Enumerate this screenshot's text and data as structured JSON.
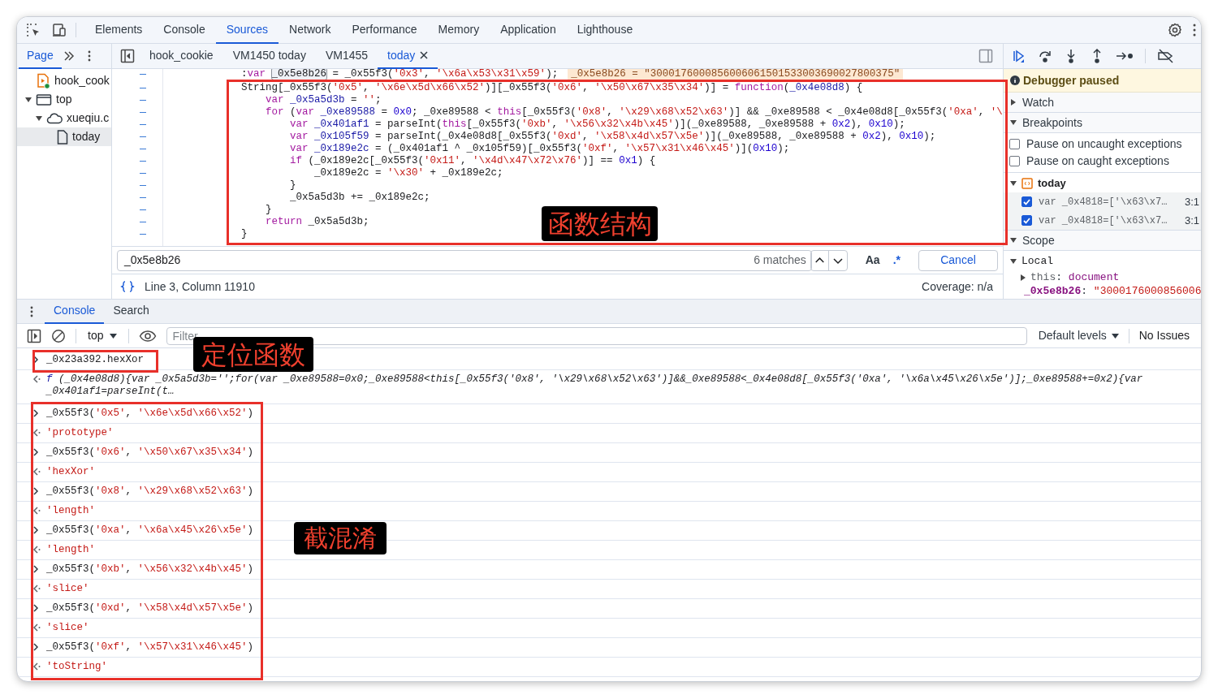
{
  "tabs": [
    {
      "label": "Elements",
      "selected": false
    },
    {
      "label": "Console",
      "selected": false
    },
    {
      "label": "Sources",
      "selected": true
    },
    {
      "label": "Network",
      "selected": false
    },
    {
      "label": "Performance",
      "selected": false
    },
    {
      "label": "Memory",
      "selected": false
    },
    {
      "label": "Application",
      "selected": false
    },
    {
      "label": "Lighthouse",
      "selected": false
    }
  ],
  "navigator": {
    "tabs": [
      {
        "label": "Page",
        "selected": true
      }
    ],
    "tree": [
      {
        "label": "hook_cook",
        "kind": "script",
        "selected": false
      },
      {
        "label": "top",
        "kind": "frame",
        "expanded": true,
        "selected": false,
        "children": [
          {
            "label": "xueqiu.c",
            "kind": "origin",
            "expanded": true,
            "selected": false,
            "children": [
              {
                "label": "today",
                "kind": "file",
                "selected": true
              }
            ]
          }
        ]
      }
    ]
  },
  "editor": {
    "tabs": [
      {
        "label": "hook_cookie",
        "selected": false,
        "closable": false
      },
      {
        "label": "VM1450 today",
        "selected": false,
        "closable": false
      },
      {
        "label": "VM1455",
        "selected": false,
        "closable": false
      },
      {
        "label": "today",
        "selected": true,
        "closable": true
      }
    ],
    "lines": [
      {
        "tokens": [
          {
            "kind": "p",
            "text": ":"
          },
          {
            "kind": "kw",
            "text": "var "
          },
          {
            "kind": "hl",
            "text": "_0x5e8b26"
          },
          {
            "kind": "p",
            "text": " = _0x55f3("
          },
          {
            "kind": "s",
            "text": "'0x3'"
          },
          {
            "kind": "p",
            "text": ", "
          },
          {
            "kind": "s",
            "text": "'\\x6a\\x53\\x31\\x59'"
          },
          {
            "kind": "p",
            "text": ");"
          }
        ],
        "inline_value": "_0x5e8b26 = \"3000176000856006061501533003690027800375\""
      },
      {
        "tokens": [
          {
            "kind": "p",
            "text": "String[_0x55f3("
          },
          {
            "kind": "s",
            "text": "'0x5'"
          },
          {
            "kind": "p",
            "text": ", "
          },
          {
            "kind": "s",
            "text": "'\\x6e\\x5d\\x66\\x52'"
          },
          {
            "kind": "p",
            "text": ")][_0x55f3("
          },
          {
            "kind": "s",
            "text": "'0x6'"
          },
          {
            "kind": "p",
            "text": ", "
          },
          {
            "kind": "s",
            "text": "'\\x50\\x67\\x35\\x34'"
          },
          {
            "kind": "p",
            "text": ")] = "
          },
          {
            "kind": "kw",
            "text": "function"
          },
          {
            "kind": "p",
            "text": "("
          },
          {
            "kind": "def",
            "text": "_0x4e08d8"
          },
          {
            "kind": "p",
            "text": ") {"
          }
        ]
      },
      {
        "tokens": [
          {
            "kind": "kw",
            "text": "    var"
          },
          {
            "kind": "def",
            "text": " _0x5a5d3b"
          },
          {
            "kind": "p",
            "text": " = "
          },
          {
            "kind": "s",
            "text": "''"
          },
          {
            "kind": "p",
            "text": ";"
          }
        ]
      },
      {
        "tokens": [
          {
            "kind": "kw",
            "text": "    for"
          },
          {
            "kind": "p",
            "text": " ("
          },
          {
            "kind": "kw",
            "text": "var"
          },
          {
            "kind": "def",
            "text": " _0xe89588"
          },
          {
            "kind": "p",
            "text": " = "
          },
          {
            "kind": "n",
            "text": "0x0"
          },
          {
            "kind": "p",
            "text": "; _0xe89588 < "
          },
          {
            "kind": "kw",
            "text": "this"
          },
          {
            "kind": "p",
            "text": "[_0x55f3("
          },
          {
            "kind": "s",
            "text": "'0x8'"
          },
          {
            "kind": "p",
            "text": ", "
          },
          {
            "kind": "s",
            "text": "'\\x29\\x68\\x52\\x63'"
          },
          {
            "kind": "p",
            "text": ")] && _0xe89588 < _0x4e08d8[_0x55f3("
          },
          {
            "kind": "s",
            "text": "'0xa'"
          },
          {
            "kind": "p",
            "text": ", "
          },
          {
            "kind": "s",
            "text": "'\\"
          }
        ]
      },
      {
        "tokens": [
          {
            "kind": "kw",
            "text": "        var"
          },
          {
            "kind": "def",
            "text": " _0x401af1"
          },
          {
            "kind": "p",
            "text": " = parseInt("
          },
          {
            "kind": "kw",
            "text": "this"
          },
          {
            "kind": "p",
            "text": "[_0x55f3("
          },
          {
            "kind": "s",
            "text": "'0xb'"
          },
          {
            "kind": "p",
            "text": ", "
          },
          {
            "kind": "s",
            "text": "'\\x56\\x32\\x4b\\x45'"
          },
          {
            "kind": "p",
            "text": ")](_0xe89588, _0xe89588 + "
          },
          {
            "kind": "n",
            "text": "0x2"
          },
          {
            "kind": "p",
            "text": "), "
          },
          {
            "kind": "n",
            "text": "0x10"
          },
          {
            "kind": "p",
            "text": ");"
          }
        ]
      },
      {
        "tokens": [
          {
            "kind": "kw",
            "text": "        var"
          },
          {
            "kind": "def",
            "text": " _0x105f59"
          },
          {
            "kind": "p",
            "text": " = parseInt(_0x4e08d8[_0x55f3("
          },
          {
            "kind": "s",
            "text": "'0xd'"
          },
          {
            "kind": "p",
            "text": ", "
          },
          {
            "kind": "s",
            "text": "'\\x58\\x4d\\x57\\x5e'"
          },
          {
            "kind": "p",
            "text": ")](_0xe89588, _0xe89588 + "
          },
          {
            "kind": "n",
            "text": "0x2"
          },
          {
            "kind": "p",
            "text": "), "
          },
          {
            "kind": "n",
            "text": "0x10"
          },
          {
            "kind": "p",
            "text": ");"
          }
        ]
      },
      {
        "tokens": [
          {
            "kind": "kw",
            "text": "        var"
          },
          {
            "kind": "def",
            "text": " _0x189e2c"
          },
          {
            "kind": "p",
            "text": " = (_0x401af1 ^ _0x105f59)[_0x55f3("
          },
          {
            "kind": "s",
            "text": "'0xf'"
          },
          {
            "kind": "p",
            "text": ", "
          },
          {
            "kind": "s",
            "text": "'\\x57\\x31\\x46\\x45'"
          },
          {
            "kind": "p",
            "text": ")]("
          },
          {
            "kind": "n",
            "text": "0x10"
          },
          {
            "kind": "p",
            "text": ");"
          }
        ]
      },
      {
        "tokens": [
          {
            "kind": "kw",
            "text": "        if"
          },
          {
            "kind": "p",
            "text": " (_0x189e2c[_0x55f3("
          },
          {
            "kind": "s",
            "text": "'0x11'"
          },
          {
            "kind": "p",
            "text": ", "
          },
          {
            "kind": "s",
            "text": "'\\x4d\\x47\\x72\\x76'"
          },
          {
            "kind": "p",
            "text": ")] == "
          },
          {
            "kind": "n",
            "text": "0x1"
          },
          {
            "kind": "p",
            "text": ") {"
          }
        ]
      },
      {
        "tokens": [
          {
            "kind": "p",
            "text": "            _0x189e2c = "
          },
          {
            "kind": "s",
            "text": "'\\x30'"
          },
          {
            "kind": "p",
            "text": " + _0x189e2c;"
          }
        ]
      },
      {
        "tokens": [
          {
            "kind": "p",
            "text": "        }"
          }
        ]
      },
      {
        "tokens": [
          {
            "kind": "p",
            "text": "        _0x5a5d3b += _0x189e2c;"
          }
        ]
      },
      {
        "tokens": [
          {
            "kind": "p",
            "text": "    }"
          }
        ]
      },
      {
        "tokens": [
          {
            "kind": "kw",
            "text": "    return"
          },
          {
            "kind": "p",
            "text": " _0x5a5d3b;"
          }
        ]
      },
      {
        "tokens": [
          {
            "kind": "p",
            "text": "}"
          }
        ]
      }
    ],
    "search": {
      "value": "_0x5e8b26",
      "matches": "6 matches",
      "case_label": "Aa",
      "regex_label": ".*",
      "cancel": "Cancel"
    },
    "status": {
      "position": "Line 3, Column 11910",
      "coverage": "Coverage: n/a"
    }
  },
  "debugger": {
    "banner": "Debugger paused",
    "watch": {
      "label": "Watch",
      "expanded": false
    },
    "breakpoints": {
      "label": "Breakpoints",
      "expanded": true,
      "options": [
        {
          "label": "Pause on uncaught exceptions",
          "checked": false
        },
        {
          "label": "Pause on caught exceptions",
          "checked": false
        }
      ],
      "files": [
        {
          "name": "today",
          "expanded": true,
          "items": [
            {
              "code": "var _0x4818=['\\x63\\x7…",
              "location": "3:1",
              "checked": true
            },
            {
              "code": "var _0x4818=['\\x63\\x7…",
              "location": "3:1",
              "checked": true
            }
          ]
        }
      ]
    },
    "scope": {
      "label": "Scope",
      "expanded": true,
      "groups": [
        {
          "label": "Local",
          "expanded": true,
          "entries": [
            {
              "key": "this",
              "separator": ":",
              "value": "document",
              "kind": "object",
              "expanded": false
            },
            {
              "key": "_0x5e8b26",
              "separator": ":",
              "value": "\"3000176000856006",
              "kind": "string"
            }
          ]
        }
      ]
    }
  },
  "console": {
    "tabs": [
      {
        "label": "Console",
        "selected": true
      },
      {
        "label": "Search",
        "selected": false
      }
    ],
    "context": "top",
    "filter_placeholder": "Filter",
    "levels": "Default levels",
    "issues": "No Issues",
    "messages": [
      {
        "kind": "input",
        "tokens": [
          {
            "kind": "p",
            "text": "_0x23a392.hexXor"
          }
        ]
      },
      {
        "kind": "function",
        "prefix": "f",
        "text": "(_0x4e08d8){var _0x5a5d3b='';for(var _0xe89588=0x0;_0xe89588<this[_0x55f3('0x8', '\\x29\\x68\\x52\\x63')]&&_0xe89588<_0x4e08d8[_0x55f3('0xa', '\\x6a\\x45\\x26\\x5e')];_0xe89588+=0x2){var _0x401af1=parseInt(t…"
      },
      {
        "kind": "input",
        "tokens": [
          {
            "kind": "p",
            "text": "_0x55f3("
          },
          {
            "kind": "s",
            "text": "'0x5'"
          },
          {
            "kind": "p",
            "text": ", "
          },
          {
            "kind": "s",
            "text": "'\\x6e\\x5d\\x66\\x52'"
          },
          {
            "kind": "p",
            "text": ")"
          }
        ]
      },
      {
        "kind": "output",
        "text": "'prototype'"
      },
      {
        "kind": "input",
        "tokens": [
          {
            "kind": "p",
            "text": "_0x55f3("
          },
          {
            "kind": "s",
            "text": "'0x6'"
          },
          {
            "kind": "p",
            "text": ", "
          },
          {
            "kind": "s",
            "text": "'\\x50\\x67\\x35\\x34'"
          },
          {
            "kind": "p",
            "text": ")"
          }
        ]
      },
      {
        "kind": "output",
        "text": "'hexXor'"
      },
      {
        "kind": "input",
        "tokens": [
          {
            "kind": "p",
            "text": "_0x55f3("
          },
          {
            "kind": "s",
            "text": "'0x8'"
          },
          {
            "kind": "p",
            "text": ", "
          },
          {
            "kind": "s",
            "text": "'\\x29\\x68\\x52\\x63'"
          },
          {
            "kind": "p",
            "text": ")"
          }
        ]
      },
      {
        "kind": "output",
        "text": "'length'"
      },
      {
        "kind": "input",
        "tokens": [
          {
            "kind": "p",
            "text": "_0x55f3("
          },
          {
            "kind": "s",
            "text": "'0xa'"
          },
          {
            "kind": "p",
            "text": ", "
          },
          {
            "kind": "s",
            "text": "'\\x6a\\x45\\x26\\x5e'"
          },
          {
            "kind": "p",
            "text": ")"
          }
        ]
      },
      {
        "kind": "output",
        "text": "'length'"
      },
      {
        "kind": "input",
        "tokens": [
          {
            "kind": "p",
            "text": "_0x55f3("
          },
          {
            "kind": "s",
            "text": "'0xb'"
          },
          {
            "kind": "p",
            "text": ", "
          },
          {
            "kind": "s",
            "text": "'\\x56\\x32\\x4b\\x45'"
          },
          {
            "kind": "p",
            "text": ")"
          }
        ]
      },
      {
        "kind": "output",
        "text": "'slice'"
      },
      {
        "kind": "input",
        "tokens": [
          {
            "kind": "p",
            "text": "_0x55f3("
          },
          {
            "kind": "s",
            "text": "'0xd'"
          },
          {
            "kind": "p",
            "text": ", "
          },
          {
            "kind": "s",
            "text": "'\\x58\\x4d\\x57\\x5e'"
          },
          {
            "kind": "p",
            "text": ")"
          }
        ]
      },
      {
        "kind": "output",
        "text": "'slice'"
      },
      {
        "kind": "input",
        "tokens": [
          {
            "kind": "p",
            "text": "_0x55f3("
          },
          {
            "kind": "s",
            "text": "'0xf'"
          },
          {
            "kind": "p",
            "text": ", "
          },
          {
            "kind": "s",
            "text": "'\\x57\\x31\\x46\\x45'"
          },
          {
            "kind": "p",
            "text": ")"
          }
        ]
      },
      {
        "kind": "output",
        "text": "'toString'"
      }
    ]
  },
  "annotations": [
    {
      "text": "函数结构"
    },
    {
      "text": "定位函数"
    },
    {
      "text": "截混淆"
    }
  ]
}
